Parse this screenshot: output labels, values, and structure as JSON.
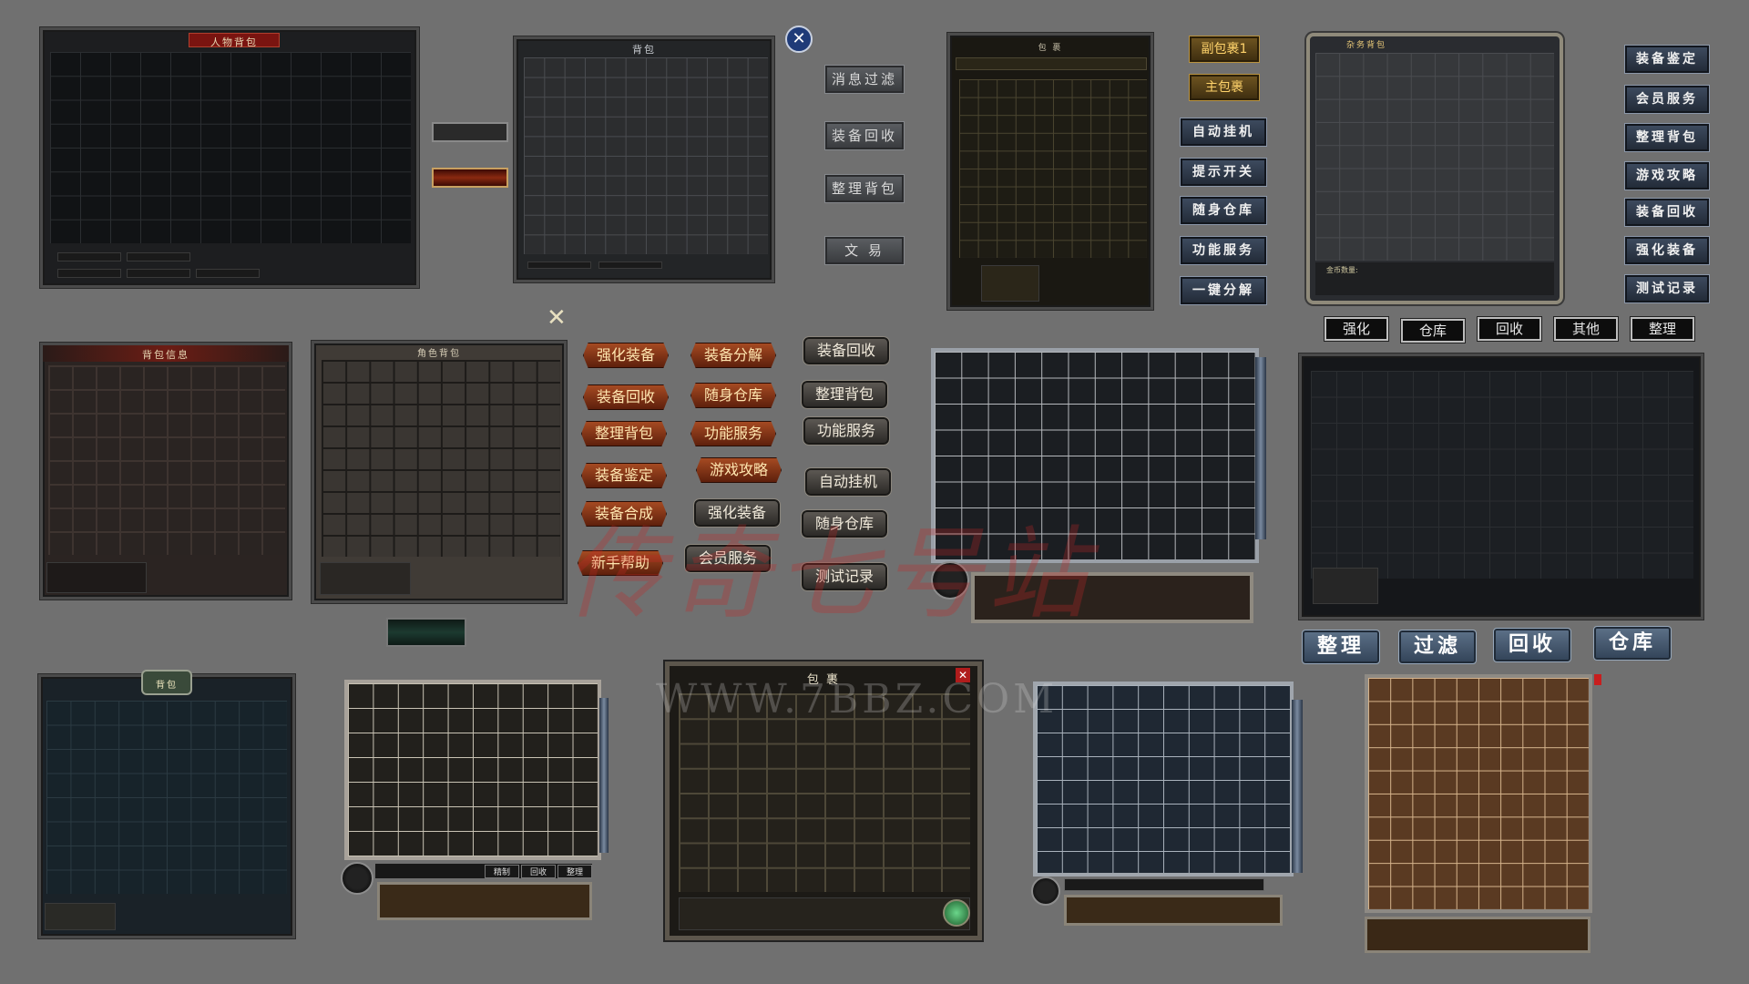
{
  "panels": {
    "p1_title": "人物背包",
    "p2_title": "背包",
    "p3_title": "包  裹",
    "p4_title": "杂务背包",
    "p4_gold_label": "金币数量:",
    "p5_title": "背包信息",
    "p6_title": "角色背包",
    "p7_title": "背包",
    "p8_title": "包 裹"
  },
  "gray_buttons": [
    "消息过滤",
    "装备回收",
    "整理背包",
    "文  易"
  ],
  "gold_buttons": [
    "副包裹1",
    "主包裹"
  ],
  "blue_buttons_mid": [
    "自动挂机",
    "提示开关",
    "随身仓库",
    "功能服务",
    "一键分解"
  ],
  "blue_buttons_right": [
    "装备鉴定",
    "会员服务",
    "整理背包",
    "游戏攻略",
    "装备回收",
    "强化装备",
    "测试记录"
  ],
  "black_tabs": [
    "强化",
    "仓库",
    "回收",
    "其他",
    "整理"
  ],
  "red_buttons_col1": [
    "强化装备",
    "装备回收",
    "整理背包",
    "装备鉴定",
    "装备合成",
    "新手帮助"
  ],
  "red_buttons_col2": [
    "装备分解",
    "随身仓库",
    "功能服务",
    "游戏攻略"
  ],
  "stone_buttons_col2": [
    "强化装备",
    "会员服务"
  ],
  "stone_buttons_col3": [
    "装备回收",
    "整理背包",
    "功能服务",
    "自动挂机",
    "随身仓库",
    "测试记录"
  ],
  "big_buttons": [
    "整理",
    "过滤",
    "回收",
    "仓库"
  ],
  "small_tabs": [
    "精制",
    "回收",
    "整理"
  ],
  "watermark": {
    "main": "传奇七号站",
    "url": "WWW.7BBZ.COM"
  },
  "colors": {
    "background": "#707070",
    "red_button": "#a54a22",
    "blue_button": "#34455a",
    "gold_text": "#ffd36b"
  }
}
